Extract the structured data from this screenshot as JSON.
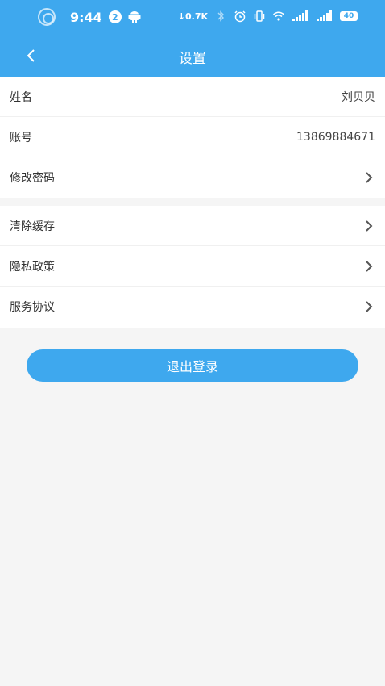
{
  "statusbar": {
    "time": "9:44",
    "notification_count": "2",
    "net_speed": "0.7K",
    "battery": "40"
  },
  "header": {
    "title": "设置"
  },
  "profile": {
    "name_label": "姓名",
    "name_value": "刘贝贝",
    "account_label": "账号",
    "account_value": "13869884671",
    "change_password_label": "修改密码"
  },
  "menu": {
    "items": [
      {
        "label": "清除缓存"
      },
      {
        "label": "隐私政策"
      },
      {
        "label": "服务协议"
      }
    ]
  },
  "logout_label": "退出登录",
  "colors": {
    "primary": "#3ea8ee",
    "background": "#f5f5f5"
  }
}
